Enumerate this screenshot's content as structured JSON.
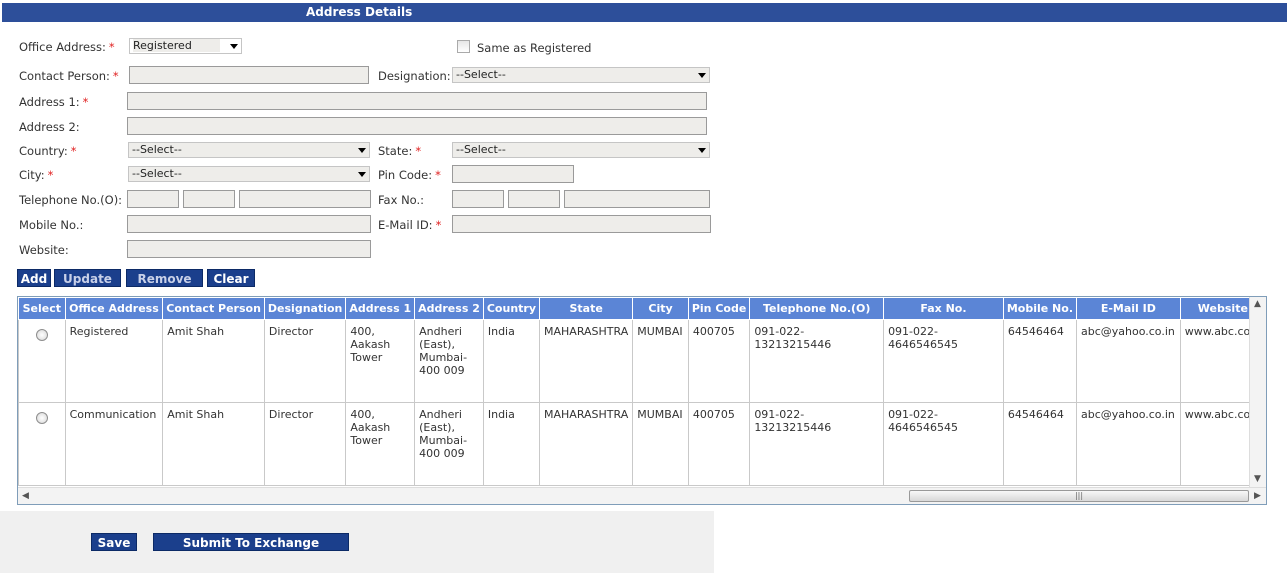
{
  "header": {
    "title": "Address Details"
  },
  "form": {
    "office_address": {
      "label": "Office Address:",
      "value": "Registered"
    },
    "same_as_registered": {
      "label": "Same as Registered",
      "checked": false
    },
    "contact_person": {
      "label": "Contact Person:",
      "value": ""
    },
    "designation": {
      "label": "Designation:",
      "value": "--Select--"
    },
    "address1": {
      "label": "Address 1:",
      "value": ""
    },
    "address2": {
      "label": "Address 2:",
      "value": ""
    },
    "country": {
      "label": "Country:",
      "value": "--Select--"
    },
    "state": {
      "label": "State:",
      "value": "--Select--"
    },
    "city": {
      "label": "City:",
      "value": "--Select--"
    },
    "pin_code": {
      "label": "Pin Code:",
      "value": ""
    },
    "telephone": {
      "label": "Telephone No.(O):"
    },
    "fax": {
      "label": "Fax No.:"
    },
    "mobile": {
      "label": "Mobile No.:"
    },
    "email": {
      "label": "E-Mail ID:"
    },
    "website": {
      "label": "Website:"
    },
    "required_mark": "*"
  },
  "actions": {
    "add": "Add",
    "update": "Update",
    "remove": "Remove",
    "clear": "Clear"
  },
  "grid": {
    "columns": [
      "Select",
      "Office Address",
      "Contact Person",
      "Designation",
      "Address 1",
      "Address 2",
      "Country",
      "State",
      "City",
      "Pin Code",
      "Telephone No.(O)",
      "Fax No.",
      "Mobile No.",
      "E-Mail ID",
      "Website"
    ],
    "rows": [
      {
        "office_address": "Registered",
        "contact_person": "Amit Shah",
        "designation": "Director",
        "address1": "400, Aakash Tower",
        "address2": "Andheri (East), Mumbai-400 009",
        "country": "India",
        "state": "MAHARASHTRA",
        "city": "MUMBAI",
        "pin_code": "400705",
        "telephone": "091-022-13213215446",
        "fax": "091-022-4646546545",
        "mobile": "64546464",
        "email": "abc@yahoo.co.in",
        "website": "www.abc.com"
      },
      {
        "office_address": "Communication",
        "contact_person": "Amit Shah",
        "designation": "Director",
        "address1": "400, Aakash Tower",
        "address2": "Andheri (East), Mumbai-400 009",
        "country": "India",
        "state": "MAHARASHTRA",
        "city": "MUMBAI",
        "pin_code": "400705",
        "telephone": "091-022-13213215446",
        "fax": "091-022-4646546545",
        "mobile": "64546464",
        "email": "abc@yahoo.co.in",
        "website": "www.abc.com"
      }
    ]
  },
  "footer": {
    "save": "Save",
    "submit": "Submit To Exchange"
  },
  "colors": {
    "header_bg": "#2d4f9a",
    "grid_header_bg": "#5b85d6",
    "button_bg": "#1b3f8c",
    "required": "#e02020"
  }
}
